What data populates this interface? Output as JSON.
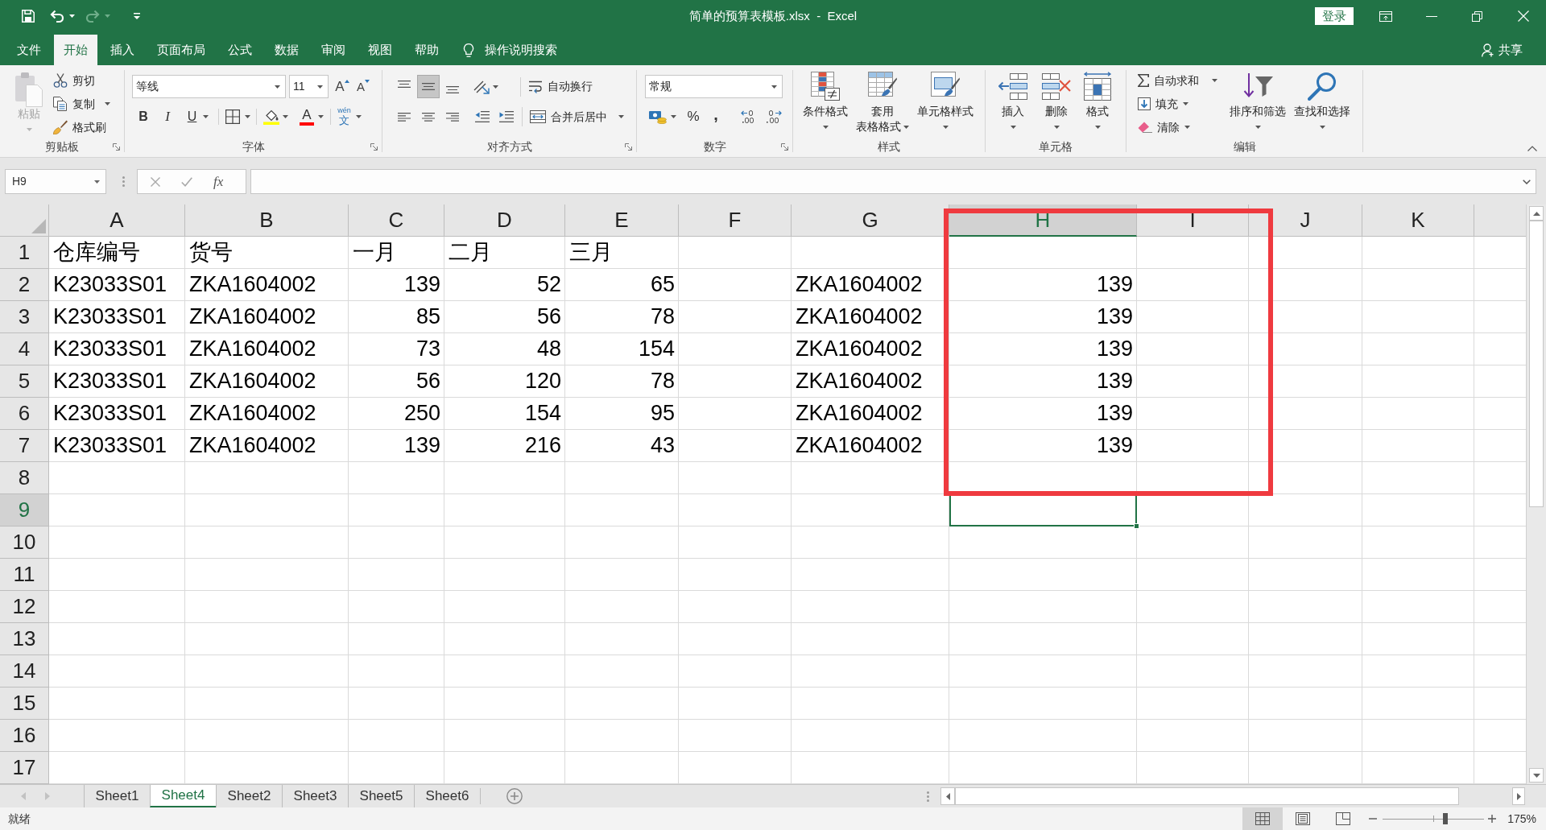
{
  "window": {
    "title": "简单的预算表模板.xlsx  -  Excel",
    "sign_in": "登录"
  },
  "quick_access": [
    {
      "kind": "save",
      "disabled": false
    },
    {
      "kind": "undo",
      "disabled": false
    },
    {
      "kind": "redo",
      "disabled": true
    },
    {
      "kind": "customize",
      "disabled": false
    }
  ],
  "ribbon_tabs": [
    {
      "label": "文件",
      "selected": false
    },
    {
      "label": "开始",
      "selected": true
    },
    {
      "label": "插入",
      "selected": false
    },
    {
      "label": "页面布局",
      "selected": false
    },
    {
      "label": "公式",
      "selected": false
    },
    {
      "label": "数据",
      "selected": false
    },
    {
      "label": "审阅",
      "selected": false
    },
    {
      "label": "视图",
      "selected": false
    },
    {
      "label": "帮助",
      "selected": false
    }
  ],
  "tell_me": {
    "placeholder": "操作说明搜索"
  },
  "share": "共享",
  "ribbon": {
    "clipboard": {
      "label": "剪贴板",
      "paste": {
        "label": "粘贴",
        "disabled": true
      },
      "cut": "剪切",
      "copy": "复制",
      "format_painter": "格式刷"
    },
    "font": {
      "label": "字体",
      "font_name": "等线",
      "font_size": "11",
      "grow": "A",
      "shrink": "A",
      "bold": "B",
      "italic": "I",
      "underline": "U",
      "font_color": "A",
      "phonetic": {
        "ruby": "wén",
        "base": "文"
      }
    },
    "alignment": {
      "label": "对齐方式",
      "vertical": [
        {
          "kind": "top",
          "selected": false
        },
        {
          "kind": "middle",
          "selected": true
        },
        {
          "kind": "bottom",
          "selected": false
        }
      ],
      "horizontal": [
        {
          "kind": "left",
          "selected": false
        },
        {
          "kind": "center",
          "selected": false
        },
        {
          "kind": "right",
          "selected": false
        }
      ],
      "wrap_text": "自动换行",
      "merge_center": "合并后居中"
    },
    "number": {
      "label": "数字",
      "format": "常规",
      "percent": "%",
      "comma": ","
    },
    "styles": {
      "label": "样式",
      "buttons": [
        {
          "kind": "conditional",
          "lines": [
            "条件格式"
          ]
        },
        {
          "kind": "table",
          "lines": [
            "套用",
            "表格格式"
          ]
        },
        {
          "kind": "cell_styles",
          "lines": [
            "单元格样式"
          ]
        }
      ]
    },
    "cells": {
      "label": "单元格",
      "buttons": [
        {
          "kind": "insert",
          "label": "插入"
        },
        {
          "kind": "delete",
          "label": "删除"
        },
        {
          "kind": "format",
          "label": "格式"
        }
      ]
    },
    "editing": {
      "label": "编辑",
      "autosum": "自动求和",
      "fill": "填充",
      "clear": "清除",
      "sort_filter": "排序和筛选",
      "find_select": "查找和选择"
    }
  },
  "formula_bar": {
    "name_box": "H9",
    "function_button": "fx"
  },
  "sheet": {
    "columns": [
      {
        "label": "A",
        "selected": false
      },
      {
        "label": "B",
        "selected": false
      },
      {
        "label": "C",
        "selected": false
      },
      {
        "label": "D",
        "selected": false
      },
      {
        "label": "E",
        "selected": false
      },
      {
        "label": "F",
        "selected": false
      },
      {
        "label": "G",
        "selected": false
      },
      {
        "label": "H",
        "selected": true
      },
      {
        "label": "I",
        "selected": false
      },
      {
        "label": "J",
        "selected": false
      },
      {
        "label": "K",
        "selected": false
      }
    ],
    "rows": [
      {
        "label": "1",
        "selected": false,
        "cells": [
          {
            "kind": "text",
            "value": "仓库编号"
          },
          {
            "kind": "text",
            "value": "货号"
          },
          {
            "kind": "text",
            "value": "一月"
          },
          {
            "kind": "text",
            "value": "二月"
          },
          {
            "kind": "text",
            "value": "三月"
          }
        ]
      },
      {
        "label": "2",
        "selected": false,
        "cells": [
          {
            "kind": "text",
            "value": "K23033S01"
          },
          {
            "kind": "text",
            "value": "ZKA1604002"
          },
          {
            "kind": "number",
            "value": "139"
          },
          {
            "kind": "number",
            "value": "52"
          },
          {
            "kind": "number",
            "value": "65"
          },
          {
            "kind": "empty"
          },
          {
            "kind": "text",
            "value": "ZKA1604002"
          },
          {
            "kind": "number",
            "value": "139"
          }
        ]
      },
      {
        "label": "3",
        "selected": false,
        "cells": [
          {
            "kind": "text",
            "value": "K23033S01"
          },
          {
            "kind": "text",
            "value": "ZKA1604002"
          },
          {
            "kind": "number",
            "value": "85"
          },
          {
            "kind": "number",
            "value": "56"
          },
          {
            "kind": "number",
            "value": "78"
          },
          {
            "kind": "empty"
          },
          {
            "kind": "text",
            "value": "ZKA1604002"
          },
          {
            "kind": "number",
            "value": "139"
          }
        ]
      },
      {
        "label": "4",
        "selected": false,
        "cells": [
          {
            "kind": "text",
            "value": "K23033S01"
          },
          {
            "kind": "text",
            "value": "ZKA1604002"
          },
          {
            "kind": "number",
            "value": "73"
          },
          {
            "kind": "number",
            "value": "48"
          },
          {
            "kind": "number",
            "value": "154"
          },
          {
            "kind": "empty"
          },
          {
            "kind": "text",
            "value": "ZKA1604002"
          },
          {
            "kind": "number",
            "value": "139"
          }
        ]
      },
      {
        "label": "5",
        "selected": false,
        "cells": [
          {
            "kind": "text",
            "value": "K23033S01"
          },
          {
            "kind": "text",
            "value": "ZKA1604002"
          },
          {
            "kind": "number",
            "value": "56"
          },
          {
            "kind": "number",
            "value": "120"
          },
          {
            "kind": "number",
            "value": "78"
          },
          {
            "kind": "empty"
          },
          {
            "kind": "text",
            "value": "ZKA1604002"
          },
          {
            "kind": "number",
            "value": "139"
          }
        ]
      },
      {
        "label": "6",
        "selected": false,
        "cells": [
          {
            "kind": "text",
            "value": "K23033S01"
          },
          {
            "kind": "text",
            "value": "ZKA1604002"
          },
          {
            "kind": "number",
            "value": "250"
          },
          {
            "kind": "number",
            "value": "154"
          },
          {
            "kind": "number",
            "value": "95"
          },
          {
            "kind": "empty"
          },
          {
            "kind": "text",
            "value": "ZKA1604002"
          },
          {
            "kind": "number",
            "value": "139"
          }
        ]
      },
      {
        "label": "7",
        "selected": false,
        "cells": [
          {
            "kind": "text",
            "value": "K23033S01"
          },
          {
            "kind": "text",
            "value": "ZKA1604002"
          },
          {
            "kind": "number",
            "value": "139"
          },
          {
            "kind": "number",
            "value": "216"
          },
          {
            "kind": "number",
            "value": "43"
          },
          {
            "kind": "empty"
          },
          {
            "kind": "text",
            "value": "ZKA1604002"
          },
          {
            "kind": "number",
            "value": "139"
          }
        ]
      },
      {
        "label": "8",
        "selected": false
      },
      {
        "label": "9",
        "selected": true
      },
      {
        "label": "10",
        "selected": false
      },
      {
        "label": "11",
        "selected": false
      },
      {
        "label": "12",
        "selected": false
      },
      {
        "label": "13",
        "selected": false
      },
      {
        "label": "14",
        "selected": false
      },
      {
        "label": "15",
        "selected": false
      },
      {
        "label": "16",
        "selected": false
      },
      {
        "label": "17",
        "selected": false
      }
    ],
    "annotations": [
      {
        "kind": "rectangle"
      }
    ]
  },
  "sheet_tabs": [
    {
      "label": "Sheet1",
      "selected": false
    },
    {
      "label": "Sheet4",
      "selected": true
    },
    {
      "label": "Sheet2",
      "selected": false
    },
    {
      "label": "Sheet3",
      "selected": false
    },
    {
      "label": "Sheet5",
      "selected": false
    },
    {
      "label": "Sheet6",
      "selected": false
    }
  ],
  "status_bar": {
    "status": "就绪",
    "views": [
      {
        "kind": "normal",
        "selected": true
      },
      {
        "kind": "page_layout",
        "selected": false
      },
      {
        "kind": "page_break",
        "selected": false
      }
    ],
    "zoom": {
      "level": 0.62,
      "reading": "175%"
    }
  }
}
